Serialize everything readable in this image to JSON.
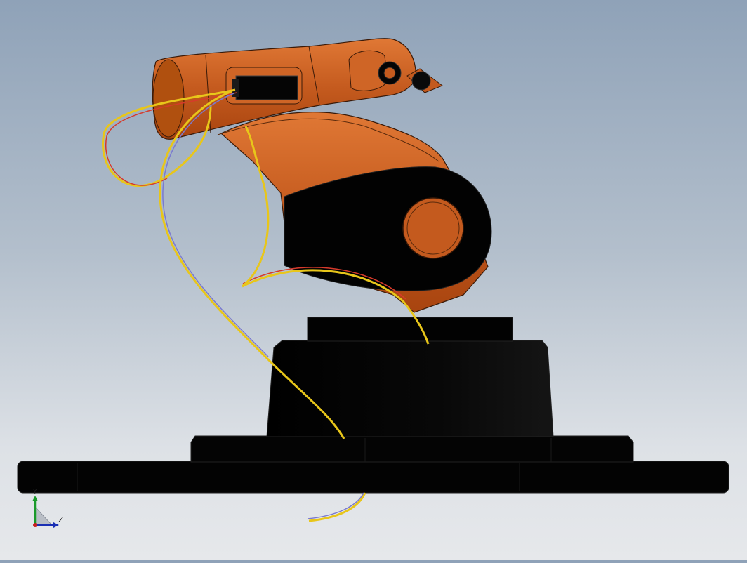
{
  "viewport": {
    "background_top": "#8fa2b8",
    "background_bottom": "#e6e8eb"
  },
  "model": {
    "arm_color": "#c45a1e",
    "arm_highlight": "#e07835",
    "body_color": "#000000",
    "wire_colors": [
      "#e8c61a",
      "#d63a2b",
      "#7a7ad0"
    ]
  },
  "triad": {
    "y_label": "Y",
    "z_label": "Z",
    "y_color": "#1a9a2a",
    "z_color": "#1a2fb4",
    "origin_color": "#c82020"
  }
}
